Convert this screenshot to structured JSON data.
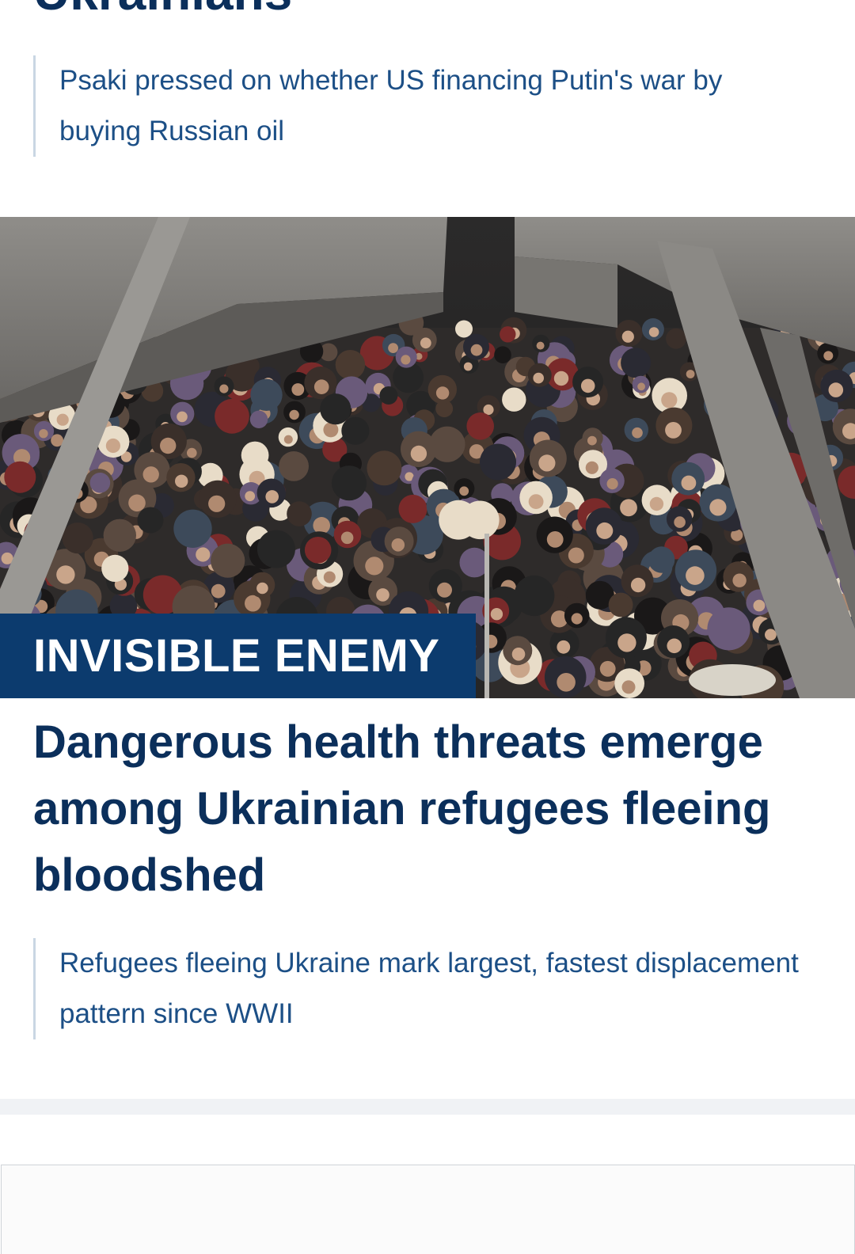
{
  "previous_story": {
    "headline_tail": "Ukrainians",
    "related_link": "Psaki pressed on whether US financing Putin's war by buying Russian oil"
  },
  "story": {
    "kicker": "INVISIBLE ENEMY",
    "headline": "Dangerous health threats emerge among Ukrainian refugees fleeing bloodshed",
    "related_link": "Refugees fleeing Ukraine mark largest, fastest displacement pattern since WWII",
    "image_alt": "Crowd of refugees sheltering under a destroyed concrete bridge with soldiers"
  },
  "colors": {
    "headline": "#0b2f5b",
    "link": "#1c4f86",
    "kicker_bg": "#0c3b6e",
    "rule": "#c9d6e3"
  }
}
